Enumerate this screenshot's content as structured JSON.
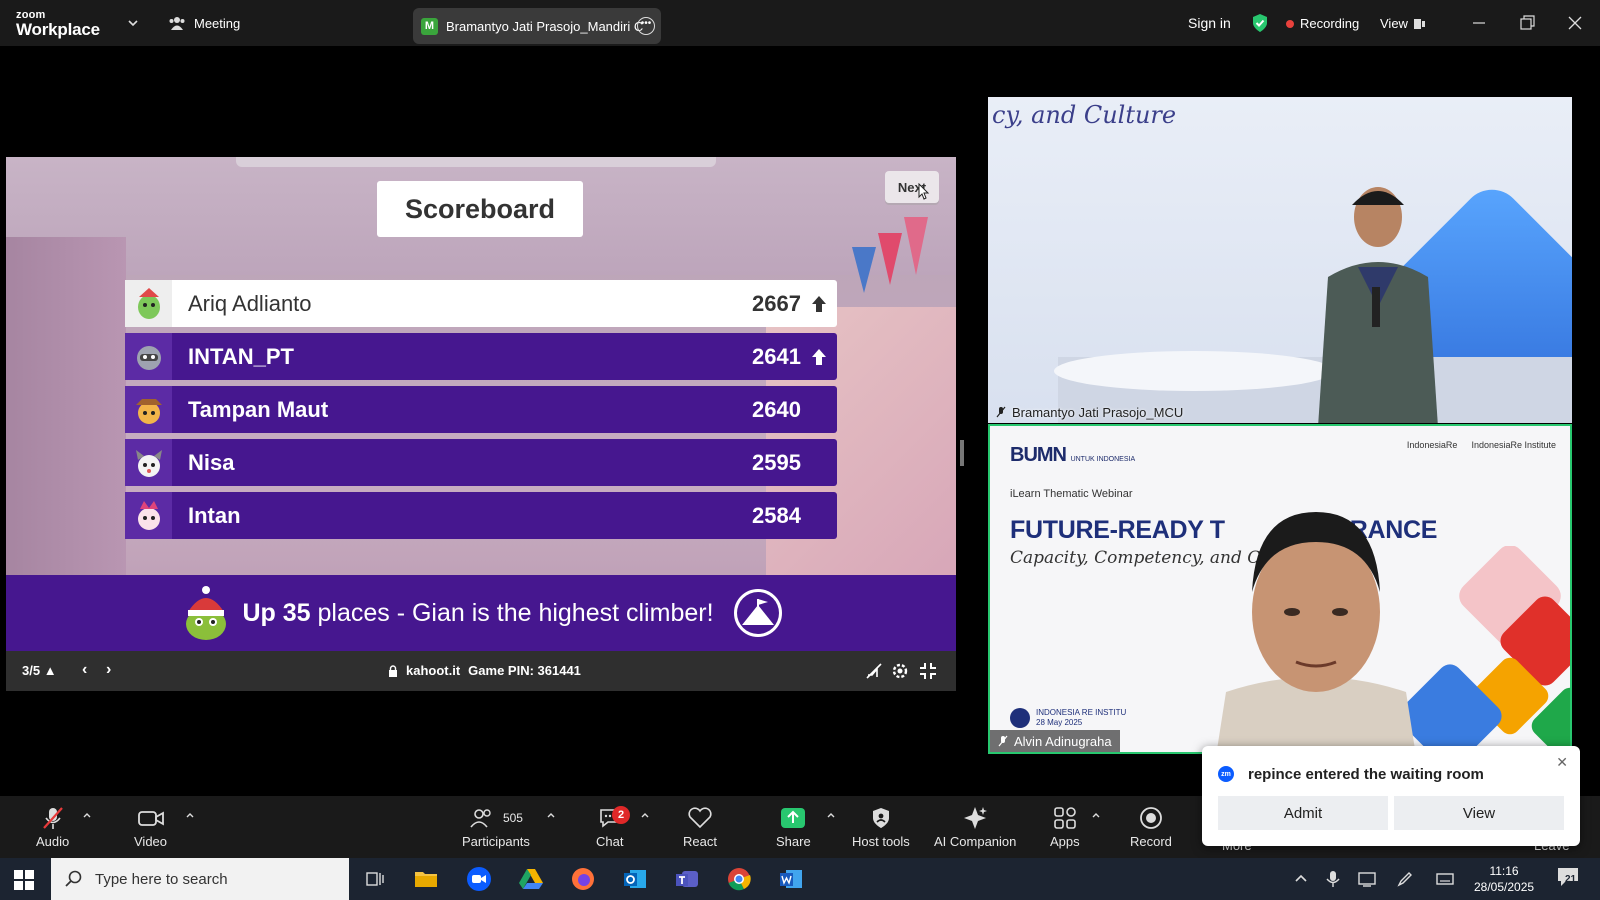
{
  "titlebar": {
    "logo_line1": "zoom",
    "logo_line2": "Workplace",
    "meeting_label": "Meeting",
    "active_tab_initial": "M",
    "active_tab_title": "Bramantyo Jati Prasojo_Mandiri C",
    "sign_in": "Sign in",
    "recording": "Recording",
    "view": "View"
  },
  "kahoot": {
    "title": "Scoreboard",
    "next_label": "Next",
    "rows": [
      {
        "name": "Ariq Adlianto",
        "score": "2667",
        "up": true
      },
      {
        "name": "INTAN_PT",
        "score": "2641",
        "up": true
      },
      {
        "name": "Tampan Maut",
        "score": "2640",
        "up": false
      },
      {
        "name": "Nisa",
        "score": "2595",
        "up": false
      },
      {
        "name": "Intan",
        "score": "2584",
        "up": false
      }
    ],
    "climber_prefix": "Up ",
    "climber_count": "35",
    "climber_suffix": " places - Gian is the highest climber!",
    "slide_counter": "3/5",
    "site": "kahoot.it",
    "pin_label": "Game PIN: 361441"
  },
  "videos": {
    "speaker1": {
      "name": "Bramantyo Jati Prasojo_MCU",
      "backdrop_text": "cy, and Culture"
    },
    "speaker2": {
      "name": "Alvin Adinugraha",
      "slide_logo": "BUMN",
      "slide_logo_sub": "UNTUK INDONESIA",
      "partner1": "IndonesiaRe",
      "partner2": "IndonesiaRe Institute",
      "slide_kicker": "iLearn Thematic Webinar",
      "slide_headline": "FUTURE-READY T          INSURANCE",
      "slide_subline": "Capacity, Competency, and Culture",
      "footer_line1": "INDONESIA RE INSTITU",
      "footer_line2": "28 May 2025"
    }
  },
  "toolbar": {
    "audio": "Audio",
    "video": "Video",
    "participants_count": "505",
    "participants": "Participants",
    "chat_badge": "2",
    "chat": "Chat",
    "react": "React",
    "share": "Share",
    "host_tools": "Host tools",
    "ai_companion": "AI Companion",
    "apps": "Apps",
    "record": "Record",
    "more": "More",
    "leave": "Leave"
  },
  "popup": {
    "message": "repince entered the waiting room",
    "admit": "Admit",
    "view": "View"
  },
  "taskbar": {
    "search_placeholder": "Type here to search",
    "time": "11:16",
    "date": "28/05/2025",
    "notif_count": "21"
  },
  "colors": {
    "kahoot_purple": "#46178f",
    "active_speaker_border": "#28c76f",
    "recording_dot": "#e8413c",
    "share_green": "#28c76f"
  }
}
